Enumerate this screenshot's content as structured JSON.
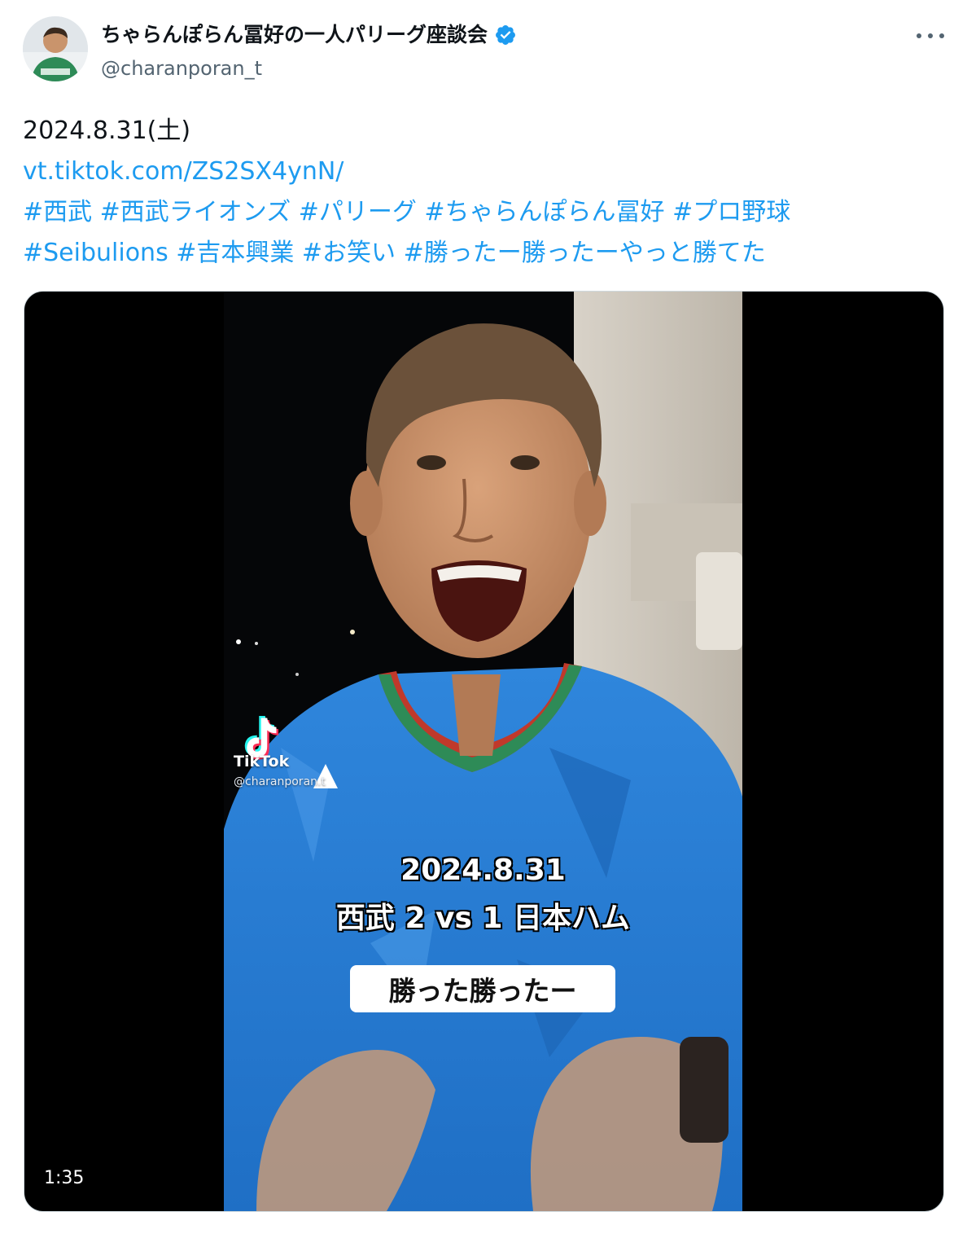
{
  "author": {
    "display_name": "ちゃらんぽらん冨好の一人パリーグ座談会",
    "handle": "@charanporan_t",
    "verified": true
  },
  "tweet": {
    "date_line": "2024.8.31(土)",
    "link": "vt.tiktok.com/ZS2SX4ynN/",
    "hashtags_line1": "#西武 #西武ライオンズ #パリーグ #ちゃらんぽらん冨好 #プロ野球",
    "hashtags_line2": "#Seibulions #吉本興業 #お笑い #勝ったー勝ったーやっと勝てた"
  },
  "video": {
    "tiktok_label": "TikTok",
    "tiktok_user": "@charanporan.t",
    "caption_date": "2024.8.31",
    "caption_score": "西武 2 vs 1 日本ハム",
    "subtitle": "勝った勝ったー",
    "duration": "1:35"
  },
  "colors": {
    "link": "#1d9bf0",
    "jersey_blue": "#2a7fd4",
    "verified": "#1d9bf0"
  }
}
